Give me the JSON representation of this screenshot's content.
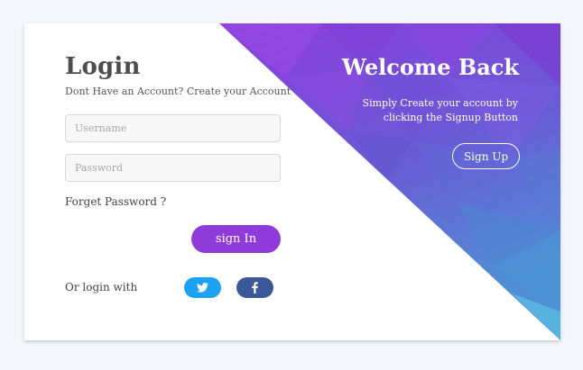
{
  "login": {
    "title": "Login",
    "subtitle": "Dont Have an Account? Create your Account",
    "username_placeholder": "Username",
    "password_placeholder": "Password",
    "forget_label": "Forget Password ?",
    "signin_label": "sign In",
    "or_login_with": "Or login with"
  },
  "social": {
    "twitter_icon": "twitter-icon",
    "facebook_icon": "facebook-icon",
    "twitter_color": "#1da1f2",
    "facebook_color": "#3b5998"
  },
  "welcome": {
    "title": "Welcome Back",
    "text": "Simply Create your account by clicking the Signup Button",
    "signup_label": "Sign Up"
  },
  "colors": {
    "accent": "#8e3bd9",
    "gradient_top": "#8a3fdc",
    "gradient_bottom": "#5aa3e0",
    "page_bg": "#f4f6fb"
  }
}
